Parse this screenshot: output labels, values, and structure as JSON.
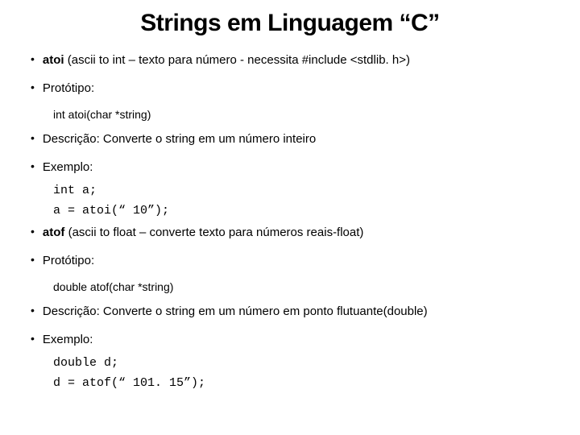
{
  "title": "Strings em Linguagem “C”",
  "lines": {
    "atoi_intro_bold": "atoi",
    "atoi_intro_rest": "  (ascii to int – texto para número - necessita #include <stdlib. h>)",
    "proto1_label": "Protótipo:",
    "proto1_sig": "int atoi(char *string)",
    "desc1": "Descrição: Converte o string em um número inteiro",
    "ex1_label": "Exemplo:",
    "ex1_code1": "int a;",
    "ex1_code2": "a = atoi(“ 10”);",
    "atof_intro_bold": "atof",
    "atof_intro_rest": " (ascii to float – converte texto para números reais-float)",
    "proto2_label": "Protótipo:",
    "proto2_sig": "double atof(char *string)",
    "desc2": "Descrição: Converte o string em um número em ponto flutuante(double)",
    "ex2_label": "Exemplo:",
    "ex2_code1": "double d;",
    "ex2_code2": "d = atof(“ 101. 15”);"
  },
  "bullet_char": "•"
}
